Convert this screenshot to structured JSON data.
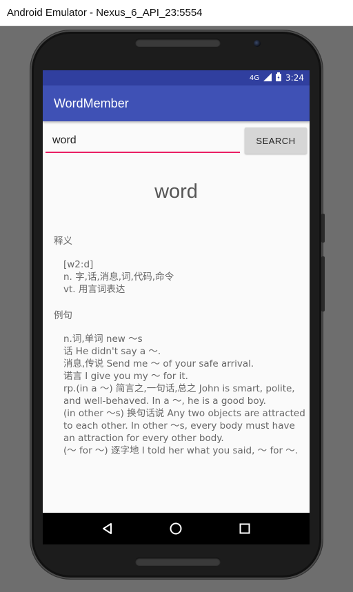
{
  "window": {
    "title": "Android Emulator - Nexus_6_API_23:5554"
  },
  "status_bar": {
    "network": "4G",
    "time": "3:24"
  },
  "app_bar": {
    "title": "WordMember"
  },
  "search": {
    "value": "word",
    "button_label": "SEARCH"
  },
  "result": {
    "word": "word",
    "definition_heading": "释义",
    "definition_lines": [
      "[w2:d]",
      "n. 字,话,消息,词,代码,命令",
      "vt. 用言词表达"
    ],
    "examples_heading": "例句",
    "example_lines": [
      "n.词,单词 new ～s",
      "话 He didn't say a ～.",
      "消息,传说 Send me ～ of your safe arrival.",
      "诺言 I give you my ～ for it.",
      "rp.(in a ～) 简言之,一句话,总之 John is smart, polite, and well-behaved. In a ～, he is a good boy.",
      "(in other ～s) 换句话说 Any two objects are attracted to each other. In other ～s, every body must have an attraction for every other body.",
      "(～ for ～) 逐字地 I told her what you said, ～ for ～."
    ]
  },
  "nav": {
    "back": "back-icon",
    "home": "home-icon",
    "recents": "recents-icon"
  },
  "colors": {
    "primary": "#3f51b5",
    "primary_dark": "#303f9f",
    "accent": "#e91e63"
  }
}
